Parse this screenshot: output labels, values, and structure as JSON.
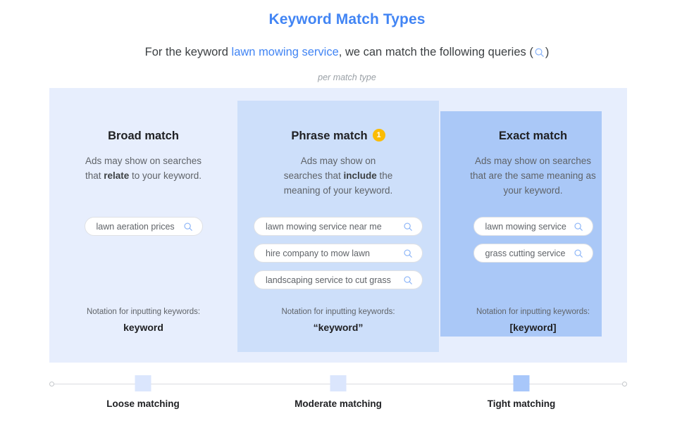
{
  "header": {
    "title": "Keyword Match Types",
    "subtitle_prefix": "For the keyword ",
    "subtitle_keyword": "lawn mowing service",
    "subtitle_mid": ", we can match the following queries (",
    "subtitle_suffix": ")",
    "search_icon": "search-icon",
    "per_match_type": "per match type"
  },
  "colors": {
    "accent_blue": "#4285f4",
    "panel_outer": "#e7eefd",
    "panel_mid": "#cddffa",
    "panel_inner": "#aac8f7",
    "badge_yellow": "#fbbc04",
    "marker_light": "#dbe6fd",
    "marker_dark": "#a8c7fa"
  },
  "columns": [
    {
      "title": "Broad match",
      "badge": null,
      "desc_parts": [
        "Ads may show on searches that ",
        "relate",
        " to your keyword."
      ],
      "queries": [
        "lawn aeration prices"
      ],
      "notation_label": "Notation for inputting keywords:",
      "notation_value": "keyword"
    },
    {
      "title": "Phrase match",
      "badge": "1",
      "desc_parts": [
        "Ads may show on searches that ",
        "include",
        " the meaning of your keyword."
      ],
      "queries": [
        "lawn mowing service near me",
        "hire company to mow lawn",
        "landscaping service to cut grass"
      ],
      "notation_label": "Notation for inputting keywords:",
      "notation_value": "“keyword”"
    },
    {
      "title": "Exact match",
      "badge": null,
      "desc_parts": [
        "Ads may show on searches that are the same meaning as your keyword.",
        "",
        ""
      ],
      "queries": [
        "lawn mowing service",
        "grass cutting service"
      ],
      "notation_label": "Notation for inputting keywords:",
      "notation_value": "[keyword]"
    }
  ],
  "scale": {
    "labels": [
      "Loose matching",
      "Moderate matching",
      "Tight matching"
    ]
  }
}
